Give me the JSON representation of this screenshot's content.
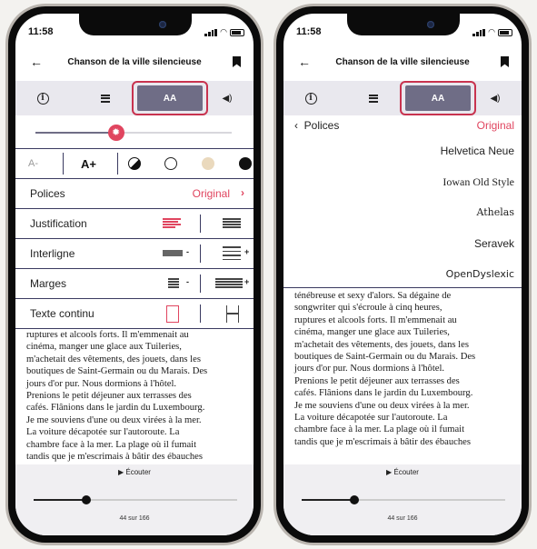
{
  "status": {
    "time": "11:58"
  },
  "nav": {
    "title": "Chanson de la ville silencieuse",
    "back_glyph": "←"
  },
  "toolbar": {
    "info_glyph": "i",
    "aa_label": "AA",
    "sound_glyph": "◀)"
  },
  "left": {
    "font_size": {
      "decrease_label": "A-",
      "increase_label": "A+"
    },
    "brightness_level": 0.41,
    "rows": {
      "fonts": {
        "label": "Polices",
        "value": "Original",
        "chevron": "›"
      },
      "justification": {
        "label": "Justification"
      },
      "spacing": {
        "label": "Interligne",
        "minus": "-",
        "plus": "+"
      },
      "margins": {
        "label": "Marges",
        "minus": "-",
        "plus": "+"
      },
      "continuous": {
        "label": "Texte continu"
      }
    },
    "reading_lines": [
      "ruptures et alcools forts. Il m'emmenait au",
      "cinéma, manger une glace aux Tuileries,",
      "m'achetait des vêtements, des jouets, dans les",
      "boutiques de Saint-Germain ou du Marais. Des",
      "jours d'or pur. Nous dormions à l'hôtel.",
      "Prenions le petit déjeuner aux terrasses des",
      "cafés. Flânions dans le jardin du Luxembourg.",
      "Je me souviens d'une ou deux virées à la mer.",
      "La voiture décapotée sur l'autoroute. La",
      "chambre face à la mer. La plage où il fumait",
      "tandis que je m'escrimais à bâtir des ébauches"
    ]
  },
  "right": {
    "fonts_panel": {
      "back_label": "Polices",
      "back_glyph": "‹",
      "selected": "Original",
      "options": [
        "Helvetica Neue",
        "Iowan Old Style",
        "Athelas",
        "Seravek",
        "OpenDyslexic"
      ]
    },
    "reading_lines": [
      "ténébreuse et sexy d'alors. Sa dégaine de",
      "songwriter qui s'écroule à cinq heures,",
      "ruptures et alcools forts. Il m'emmenait au",
      "cinéma, manger une glace aux Tuileries,",
      "m'achetait des vêtements, des jouets, dans les",
      "boutiques de Saint-Germain ou du Marais. Des",
      "jours d'or pur. Nous dormions à l'hôtel.",
      "Prenions le petit déjeuner aux terrasses des",
      "cafés. Flânions dans le jardin du Luxembourg.",
      "Je me souviens d'une ou deux virées à la mer.",
      "La voiture décapotée sur l'autoroute. La",
      "chambre face à la mer. La plage où il fumait",
      "tandis que je m'escrimais à bâtir des ébauches"
    ]
  },
  "bottom": {
    "listen_label": "▶ Écouter",
    "page_label": "44 sur 166",
    "progress_fraction": 0.26
  },
  "colors": {
    "accent": "#e0455f",
    "toolbar_selected": "#6f6d86",
    "highlight_ring": "#c8334f",
    "divider": "#3a3a60"
  }
}
